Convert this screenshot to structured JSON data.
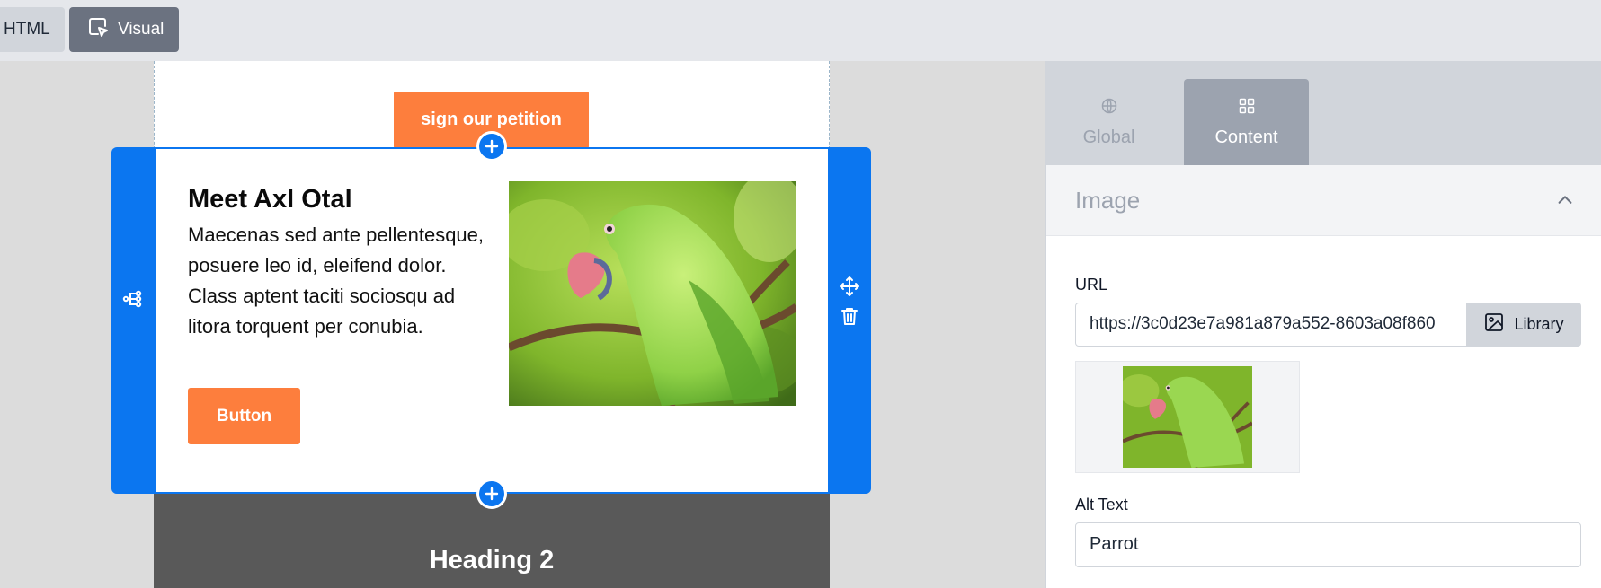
{
  "toolbar": {
    "html_label": "HTML",
    "visual_label": "Visual"
  },
  "canvas": {
    "petition_button": "sign our petition",
    "section": {
      "title": "Meet Axl Otal",
      "body": "Maecenas sed ante pellentesque, posuere leo id, eleifend dolor. Class aptent taciti sociosqu ad litora torquent per conubia.",
      "button_label": "Button",
      "image_alt": "Parrot"
    },
    "dark_section_heading": "Heading 2"
  },
  "panel": {
    "tabs": [
      {
        "label": "Global",
        "icon": "globe-icon",
        "active": false
      },
      {
        "label": "Content",
        "icon": "grid-icon",
        "active": true
      }
    ],
    "section_title": "Image",
    "url_label": "URL",
    "url_value": "https://3c0d23e7a981a879a552-8603a08f860",
    "library_label": "Library",
    "alt_label": "Alt Text",
    "alt_value": "Parrot"
  },
  "colors": {
    "accent_blue": "#0b76f0",
    "orange_button": "#fd7e3d",
    "dark_section": "#595959"
  }
}
